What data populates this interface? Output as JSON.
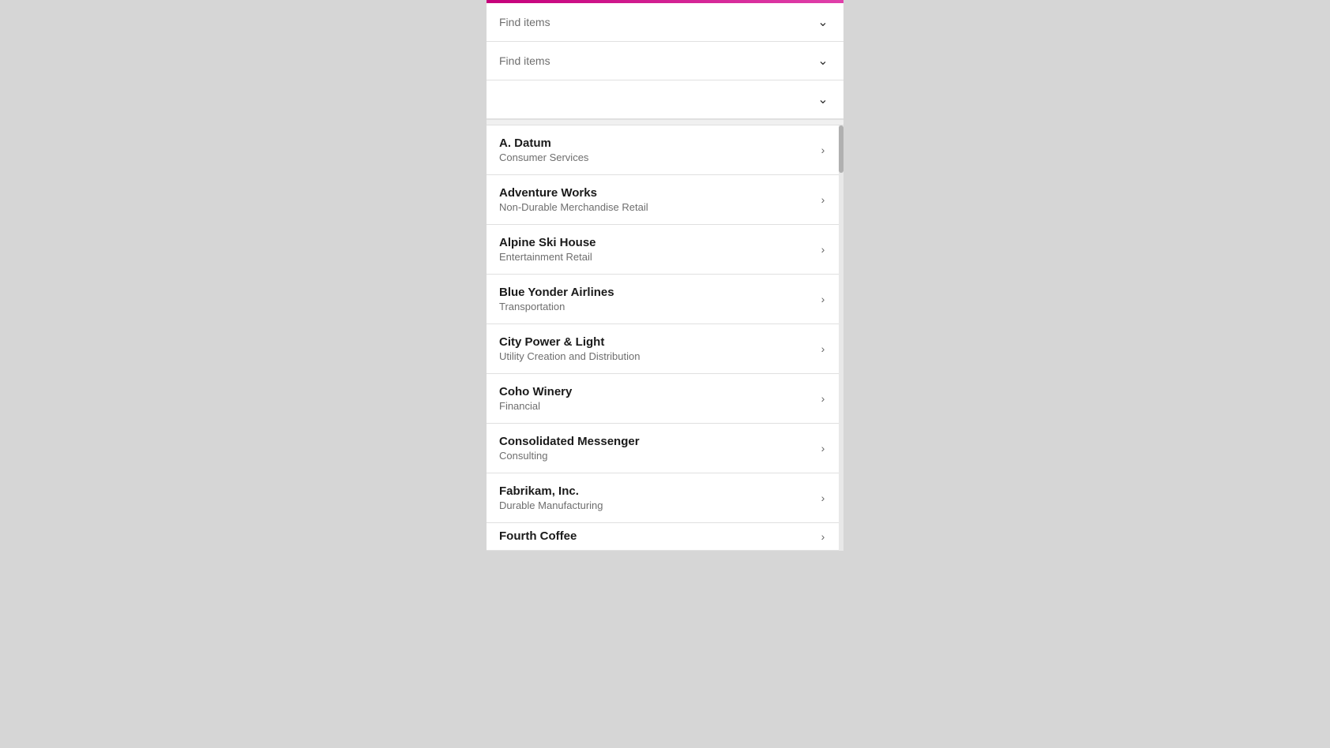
{
  "topBar": {
    "color": "#c5007a"
  },
  "filters": [
    {
      "label": "Find items",
      "id": "filter-1"
    },
    {
      "label": "Find items",
      "id": "filter-2"
    },
    {
      "label": "",
      "id": "filter-3"
    }
  ],
  "listItems": [
    {
      "id": "a-datum",
      "name": "A. Datum",
      "category": "Consumer Services"
    },
    {
      "id": "adventure-works",
      "name": "Adventure Works",
      "category": "Non-Durable Merchandise Retail"
    },
    {
      "id": "alpine-ski-house",
      "name": "Alpine Ski House",
      "category": "Entertainment Retail"
    },
    {
      "id": "blue-yonder-airlines",
      "name": "Blue Yonder Airlines",
      "category": "Transportation"
    },
    {
      "id": "city-power-light",
      "name": "City Power & Light",
      "category": "Utility Creation and Distribution"
    },
    {
      "id": "coho-winery",
      "name": "Coho Winery",
      "category": "Financial"
    },
    {
      "id": "consolidated-messenger",
      "name": "Consolidated Messenger",
      "category": "Consulting"
    },
    {
      "id": "fabrikam",
      "name": "Fabrikam, Inc.",
      "category": "Durable Manufacturing"
    },
    {
      "id": "fourth-coffee",
      "name": "Fourth Coffee",
      "category": ""
    }
  ],
  "icons": {
    "chevronDown": "⌄",
    "chevronRight": "›"
  }
}
